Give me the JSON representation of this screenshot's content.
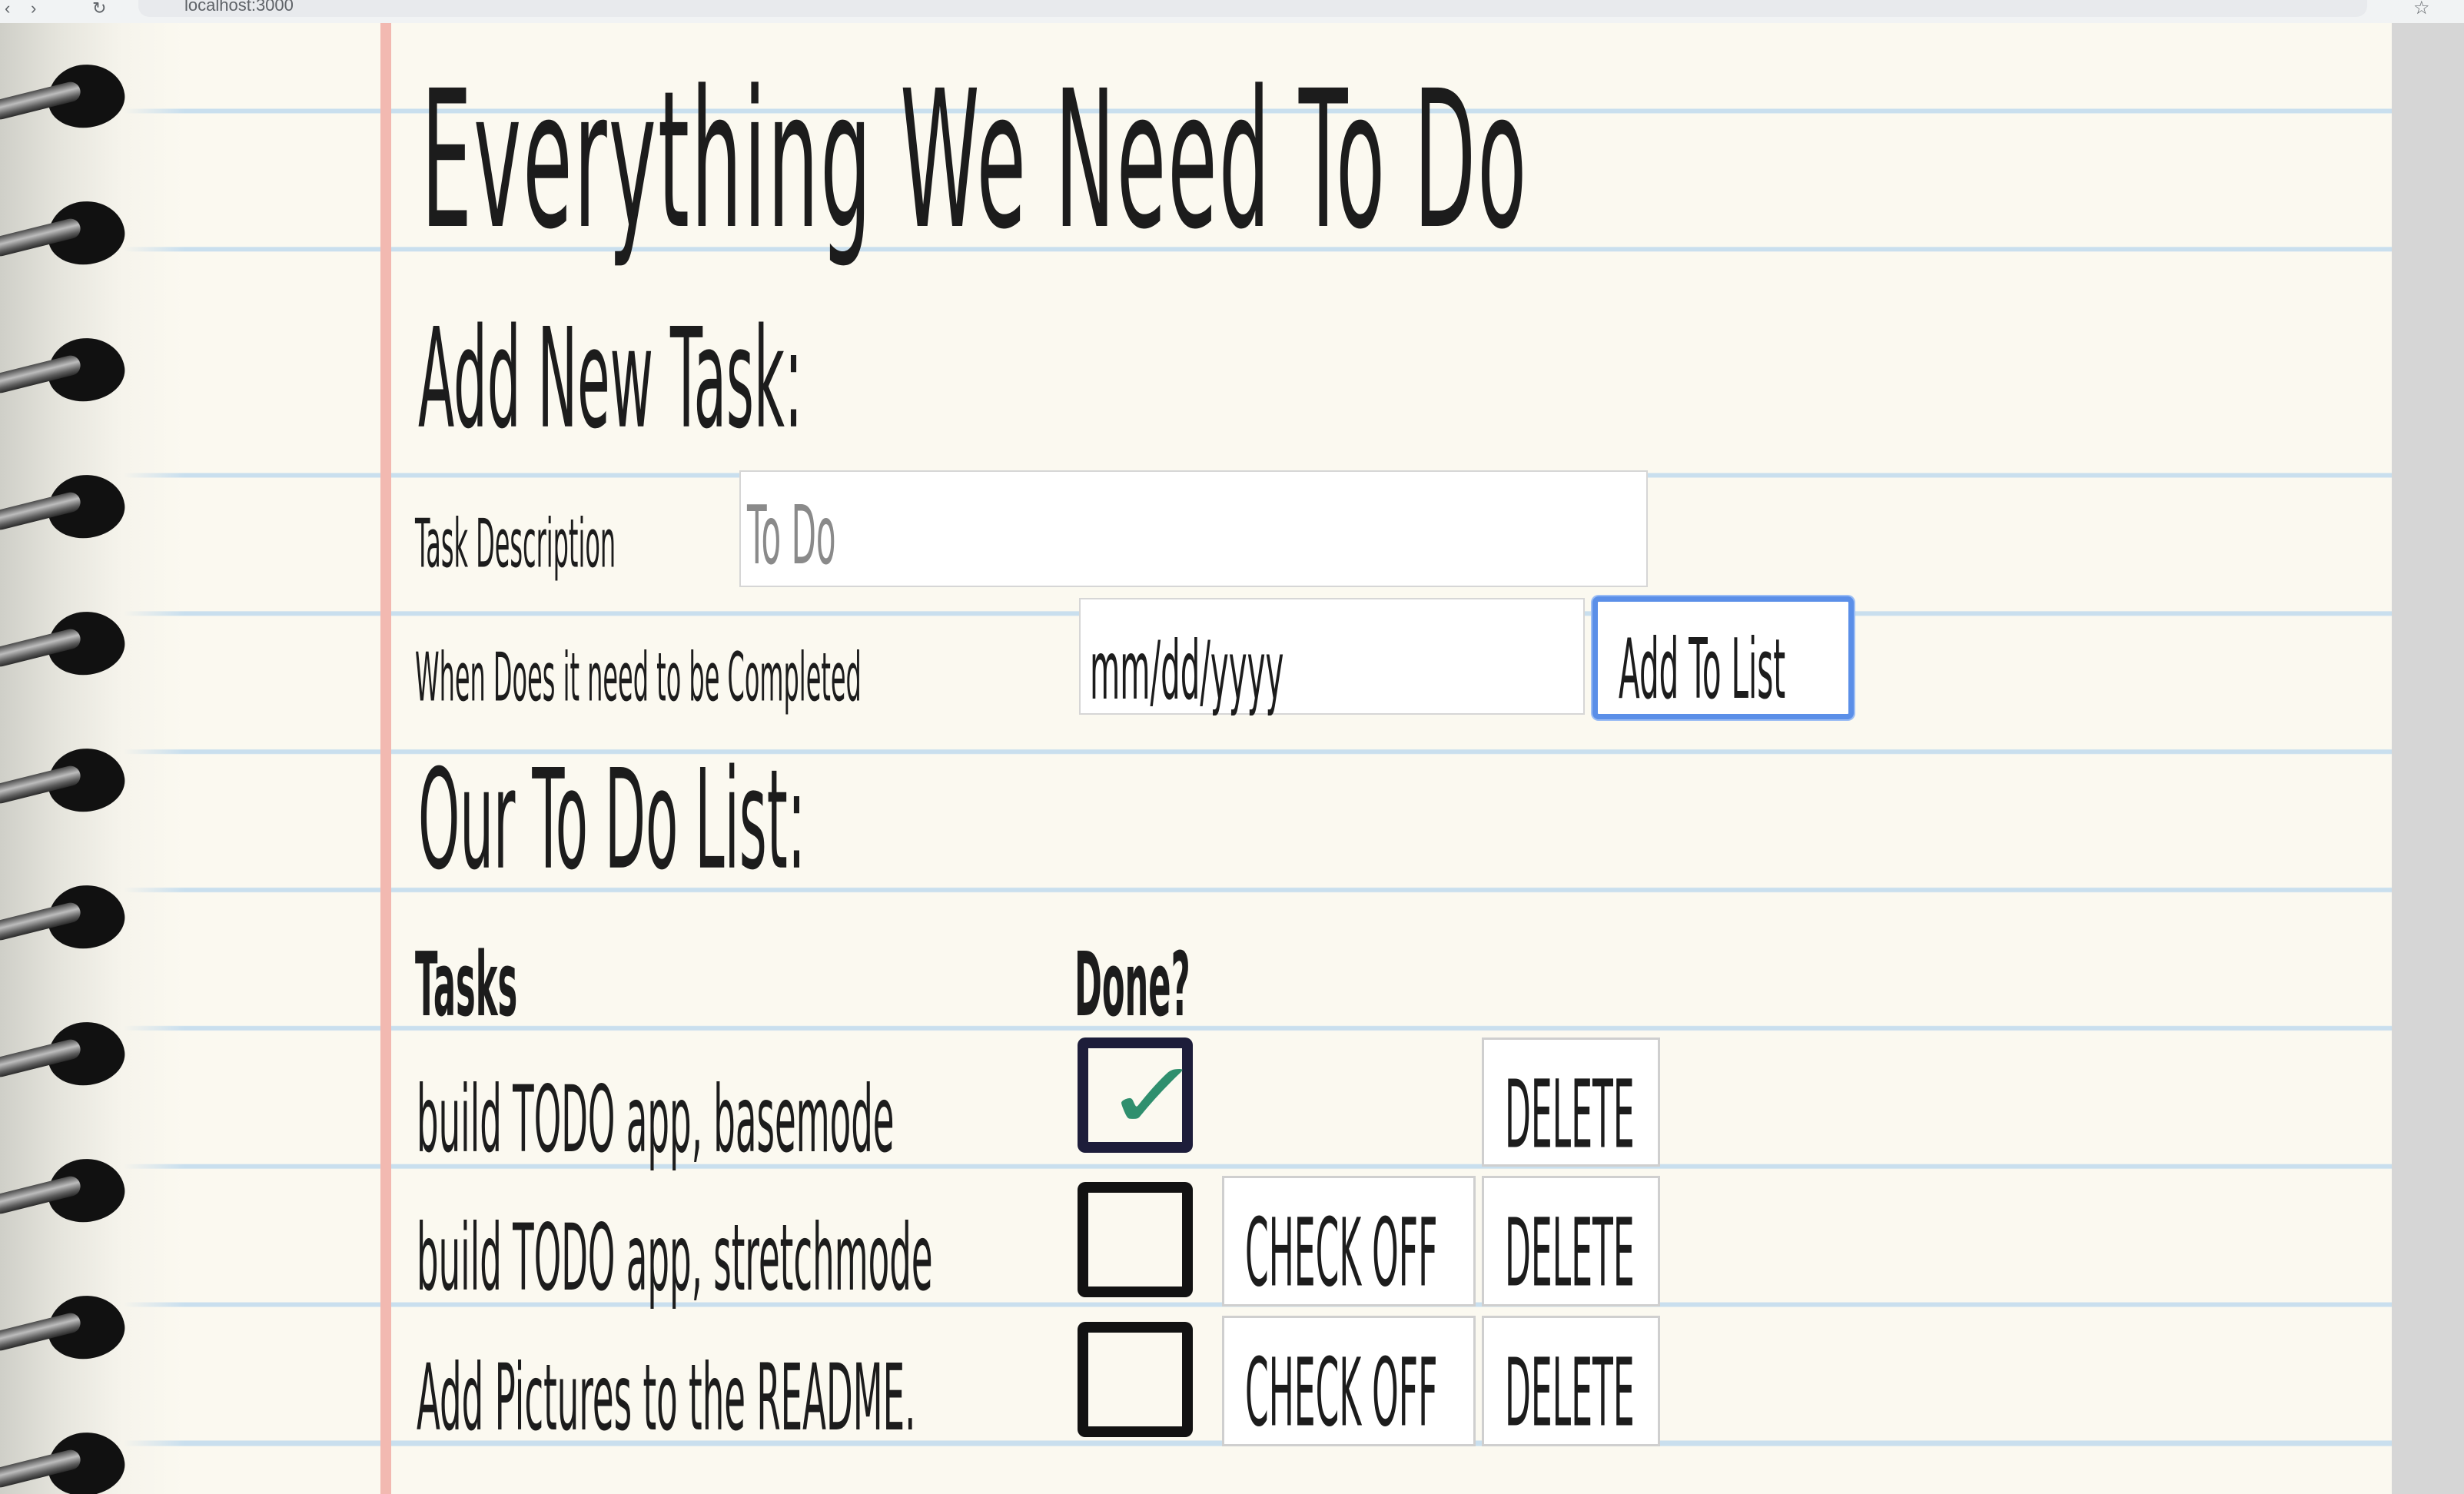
{
  "browser": {
    "address": "localhost:3000",
    "star": "☆"
  },
  "app": {
    "title": "Everything We Need To Do",
    "add_task_heading": "Add New Task:",
    "list_heading": "Our To Do List:"
  },
  "form": {
    "task_description_label": "Task Description",
    "task_description_placeholder": "To Do",
    "due_date_label": "When Does it need to be Completed",
    "due_date_placeholder": "mm/dd/yyyy",
    "add_button_label": "Add To List"
  },
  "table": {
    "columns": [
      "Tasks",
      "Done?"
    ],
    "rows": [
      {
        "task": "build TODO app, basemode",
        "done": true,
        "check_off_label": "",
        "delete_label": "DELETE"
      },
      {
        "task": "build TODO app, stretchmode",
        "done": false,
        "check_off_label": "CHECK OFF",
        "delete_label": "DELETE"
      },
      {
        "task": "Add Pictures to the README.",
        "done": false,
        "check_off_label": "CHECK OFF",
        "delete_label": "DELETE"
      }
    ]
  },
  "icons": {
    "checkmark": "✓"
  },
  "colors": {
    "paper": "#fbf9f0",
    "rule_line": "#c9dfee",
    "margin_line": "#f2b9b1",
    "focus_ring": "#5b8fe8",
    "checkmark": "#2f8f6e"
  }
}
